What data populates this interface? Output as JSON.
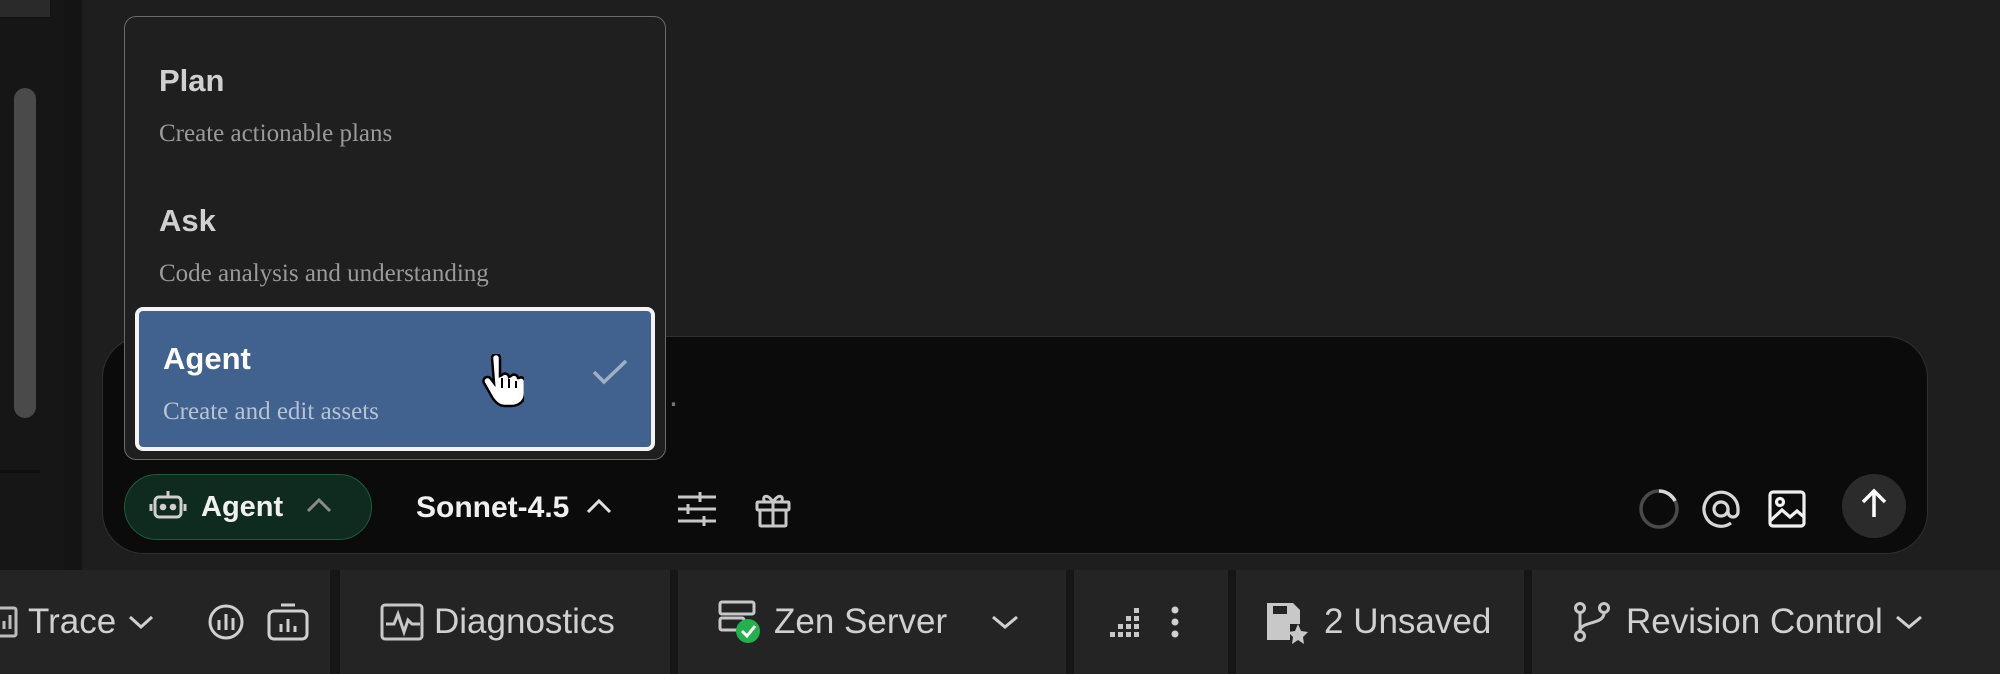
{
  "mode_menu": {
    "items": [
      {
        "title": "Plan",
        "description": "Create actionable plans"
      },
      {
        "title": "Ask",
        "description": "Code analysis and understanding"
      },
      {
        "title": "Agent",
        "description": "Create and edit assets"
      }
    ],
    "selected": "Agent"
  },
  "chat": {
    "placeholder": "ng...",
    "mode_label": "Agent",
    "model_label": "Sonnet-4.5"
  },
  "status_bar": {
    "trace_label": "Trace",
    "diagnostics_label": "Diagnostics",
    "server_label": "Zen Server",
    "unsaved_label": "2 Unsaved",
    "revision_label": "Revision Control"
  },
  "colors": {
    "accent_selected": "#41618e",
    "agent_pill_bg": "#0f2a1e",
    "server_ok": "#22b14c"
  },
  "icons": [
    "robot-icon",
    "chevron-up-icon",
    "sliders-icon",
    "gift-icon",
    "spinner-icon",
    "at-icon",
    "image-icon",
    "arrow-up-icon",
    "check-icon",
    "pointer-hand-icon",
    "chart-icon",
    "chevron-down-icon",
    "monitor-icon",
    "camera-icon",
    "waveform-icon",
    "server-icon",
    "grid-icon",
    "more-vertical-icon",
    "save-icon",
    "branch-icon"
  ]
}
